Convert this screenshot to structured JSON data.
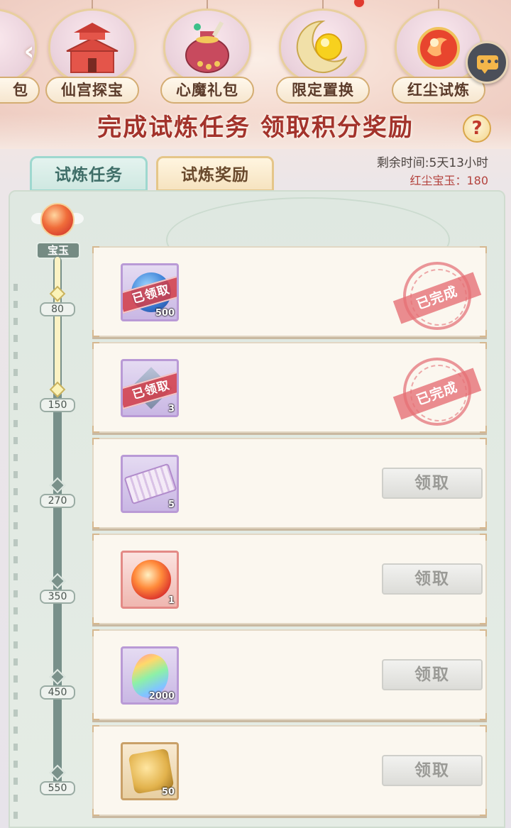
{
  "activities": [
    {
      "label": "包",
      "badge": false
    },
    {
      "label": "仙宫探宝",
      "badge": false
    },
    {
      "label": "心魔礼包",
      "badge": false
    },
    {
      "label": "限定置换",
      "badge": true
    },
    {
      "label": "红尘试炼",
      "badge": false
    }
  ],
  "headline": "完成试炼任务 领取积分奖励",
  "help_icon": "?",
  "tabs": [
    {
      "label": "试炼任务",
      "active": true
    },
    {
      "label": "试炼奖励",
      "active": false
    }
  ],
  "info": {
    "remaining_time": "剩余时间:5天13小时",
    "jade_balance": "红尘宝玉：180"
  },
  "track": {
    "title": "宝玉",
    "current": 180,
    "milestones": [
      "80",
      "150",
      "270",
      "350",
      "450",
      "550"
    ]
  },
  "rewards": [
    {
      "icon": "blue-orb-icon",
      "qty": "500",
      "claimed_label": "已领取",
      "done_label": "已完成",
      "status": "claimed"
    },
    {
      "icon": "gray-gem-icon",
      "qty": "3",
      "claimed_label": "已领取",
      "done_label": "已完成",
      "status": "claimed"
    },
    {
      "icon": "purple-ticket-icon",
      "qty": "5",
      "button_label": "领取",
      "status": "locked"
    },
    {
      "icon": "fire-orb-icon",
      "qty": "1",
      "button_label": "领取",
      "status": "locked"
    },
    {
      "icon": "rainbow-crystal-icon",
      "qty": "2000",
      "button_label": "领取",
      "status": "locked"
    },
    {
      "icon": "golden-puzzle-icon",
      "qty": "50",
      "button_label": "领取",
      "status": "locked"
    }
  ],
  "colors": {
    "headline": "#a3332b",
    "active_tab": "#cfe8e1",
    "claimed_stamp": "#d23c46",
    "disabled_button": "#dcdcd8"
  }
}
